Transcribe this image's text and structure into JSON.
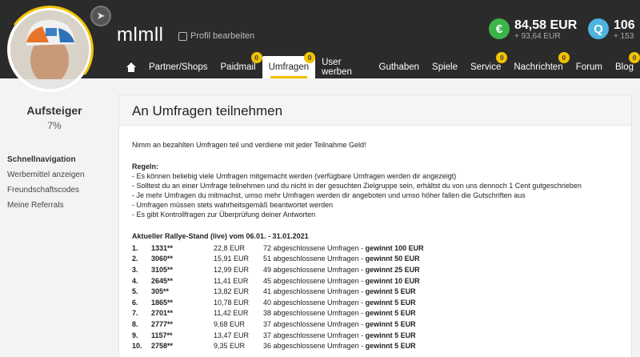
{
  "header": {
    "username": "mlmll",
    "edit_profile": "Profil bearbeiten",
    "eur_balance": "84,58",
    "eur_unit": "EUR",
    "eur_sub": "+ 93,64 EUR",
    "eur_icon": "€",
    "q_balance": "106",
    "q_sub": "+ 153",
    "q_icon": "Q"
  },
  "nav": {
    "items": [
      {
        "label": "Partner/Shops"
      },
      {
        "label": "Paidmail",
        "badge": "0"
      },
      {
        "label": "Umfragen",
        "badge": "0"
      },
      {
        "label": "User werben"
      },
      {
        "label": "Guthaben"
      },
      {
        "label": "Spiele"
      },
      {
        "label": "Service",
        "badge": "0"
      },
      {
        "label": "Nachrichten",
        "badge": "0"
      },
      {
        "label": "Forum"
      },
      {
        "label": "Blog",
        "badge": "0"
      }
    ]
  },
  "sidebar": {
    "level": "Aufsteiger",
    "level_pct": "7%",
    "quicknav_title": "Schnellnavigation",
    "items": [
      "Werbemittel anzeigen",
      "Freundschaftscodes",
      "Meine Referrals"
    ]
  },
  "main": {
    "title": "An Umfragen teilnehmen",
    "intro": "Nimm an bezahlten Umfragen teil und verdiene mit jeder Teilnahme Geld!",
    "rules_title": "Regeln:",
    "rules": [
      "- Es können beliebig viele Umfragen mitgemacht werden (verfügbare Umfragen werden dir angezeigt)",
      "- Solltest du an einer Umfrage teilnehmen und du nicht in der gesuchten Zielgruppe sein, erhältst du von uns dennoch 1 Cent gutgeschrieben",
      "- Je mehr Umfragen du mitmachst, umso mehr Umfragen werden dir angeboten und umso höher fallen die Gutschriften aus",
      "- Umfragen müssen stets wahrheitsgemäß beantwortet werden",
      "- Es gibt Kontrollfragen zur Überprüfung deiner Antworten"
    ],
    "rally_title": "Aktueller Rallye-Stand (live) vom 06.01. - 31.01.2021",
    "rally": [
      {
        "rank": "1.",
        "user": "1331**",
        "eur": "22,8 EUR",
        "desc": "72 abgeschlossene Umfragen - ",
        "prize": "gewinnt 100 EUR"
      },
      {
        "rank": "2.",
        "user": "3060**",
        "eur": "15,91 EUR",
        "desc": "51 abgeschlossene Umfragen - ",
        "prize": "gewinnt 50 EUR"
      },
      {
        "rank": "3.",
        "user": "3105**",
        "eur": "12,99 EUR",
        "desc": "49 abgeschlossene Umfragen - ",
        "prize": "gewinnt 25 EUR"
      },
      {
        "rank": "4.",
        "user": "2645**",
        "eur": "11,41 EUR",
        "desc": "45 abgeschlossene Umfragen - ",
        "prize": "gewinnt 10 EUR"
      },
      {
        "rank": "5.",
        "user": "305**",
        "eur": "13,82 EUR",
        "desc": "41 abgeschlossene Umfragen - ",
        "prize": "gewinnt 5 EUR"
      },
      {
        "rank": "6.",
        "user": "1865**",
        "eur": "10,78 EUR",
        "desc": "40 abgeschlossene Umfragen - ",
        "prize": "gewinnt 5 EUR"
      },
      {
        "rank": "7.",
        "user": "2701**",
        "eur": "11,42 EUR",
        "desc": "38 abgeschlossene Umfragen - ",
        "prize": "gewinnt 5 EUR"
      },
      {
        "rank": "8.",
        "user": "2777**",
        "eur": "9,68 EUR",
        "desc": "37 abgeschlossene Umfragen - ",
        "prize": "gewinnt 5 EUR"
      },
      {
        "rank": "9.",
        "user": "1157**",
        "eur": "13,47 EUR",
        "desc": "37 abgeschlossene Umfragen - ",
        "prize": "gewinnt 5 EUR"
      },
      {
        "rank": "10.",
        "user": "2758**",
        "eur": "9,35 EUR",
        "desc": "36 abgeschlossene Umfragen - ",
        "prize": "gewinnt 5 EUR"
      }
    ]
  },
  "colors": {
    "accent": "#f2c200",
    "header_bg": "#2b2b2b",
    "eur_green": "#3bb54a",
    "q_blue": "#4db3e0"
  }
}
